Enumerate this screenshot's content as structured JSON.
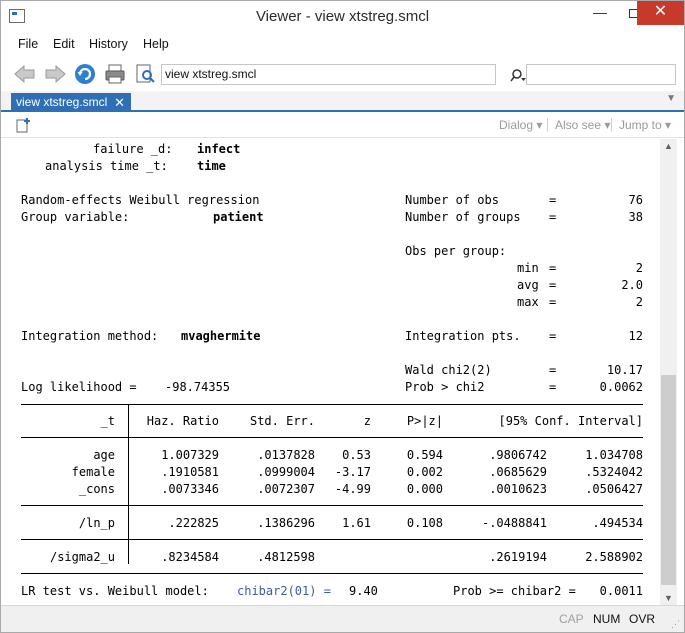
{
  "window": {
    "title": "Viewer - view xtstreg.smcl"
  },
  "menu": [
    "File",
    "Edit",
    "History",
    "Help"
  ],
  "toolbar": {
    "address_value": "view xtstreg.smcl",
    "find_value": ""
  },
  "tab": {
    "label": "view xtstreg.smcl",
    "close": "✕"
  },
  "doc_toolbar": {
    "dialog": "Dialog ▾",
    "also_see": "Also see ▾",
    "jump_to": "Jump to ▾"
  },
  "output": {
    "failure_label": "failure _d:",
    "failure_value": "infect",
    "time_label": "analysis time _t:",
    "time_value": "time",
    "model_title": "Random-effects Weibull regression",
    "group_var_label": "Group variable:",
    "group_var_value": "patient",
    "nobs_label": "Number of obs",
    "nobs_value": "76",
    "ngroups_label": "Number of groups",
    "ngroups_value": "38",
    "obs_per_group_label": "Obs per group:",
    "min_label": "min",
    "min_value": "2",
    "avg_label": "avg",
    "avg_value": "2.0",
    "max_label": "max",
    "max_value": "2",
    "integration_label": "Integration method:",
    "integration_value": "mvaghermite",
    "integration_pts_label": "Integration pts.",
    "integration_pts_value": "12",
    "wald_label": "Wald chi2(2)",
    "wald_value": "10.17",
    "loglik_label": "Log likelihood =",
    "loglik_value": "-98.74355",
    "prob_label": "Prob > chi2",
    "prob_value": "0.0062",
    "eq": "=",
    "table": {
      "headers": [
        "_t",
        "Haz. Ratio",
        "Std. Err.",
        "z",
        "P>|z|",
        "[95% Conf. Interval]"
      ],
      "rows": [
        [
          "age",
          "1.007329",
          ".0137828",
          "0.53",
          "0.594",
          ".9806742",
          "1.034708"
        ],
        [
          "female",
          ".1910581",
          ".0999004",
          "-3.17",
          "0.002",
          ".0685629",
          ".5324042"
        ],
        [
          "_cons",
          ".0073346",
          ".0072307",
          "-4.99",
          "0.000",
          ".0010623",
          ".0506427"
        ],
        [
          "/ln_p",
          ".222825",
          ".1386296",
          "1.61",
          "0.108",
          "-.0488841",
          ".494534"
        ],
        [
          "/sigma2_u",
          ".8234584",
          ".4812598",
          "",
          "",
          ".2619194",
          "2.588902"
        ]
      ]
    },
    "lr_label": "LR test vs. Weibull model:",
    "lr_stat": "chibar2(01) =",
    "lr_value": "9.40",
    "lr_prob_label": "Prob >= chibar2 =",
    "lr_prob_value": "0.0011"
  },
  "status": {
    "cap": "CAP",
    "num": "NUM",
    "ovr": "OVR"
  }
}
